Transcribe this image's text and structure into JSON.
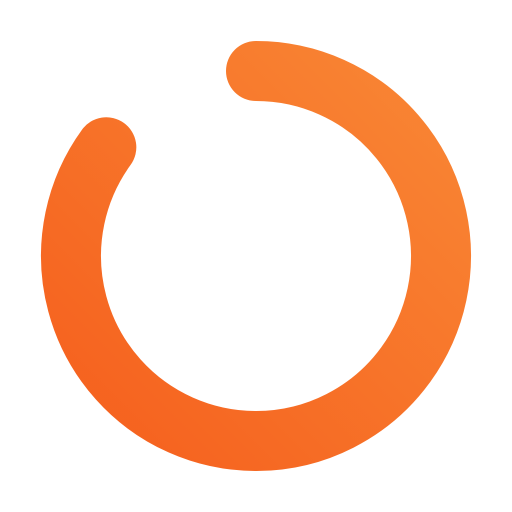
{
  "spinner": {
    "icon": "loading-ring-icon",
    "progress_fraction": 0.85,
    "colors": {
      "start": "#F5601E",
      "end": "#F98634",
      "background": "#FFFFFF"
    }
  }
}
